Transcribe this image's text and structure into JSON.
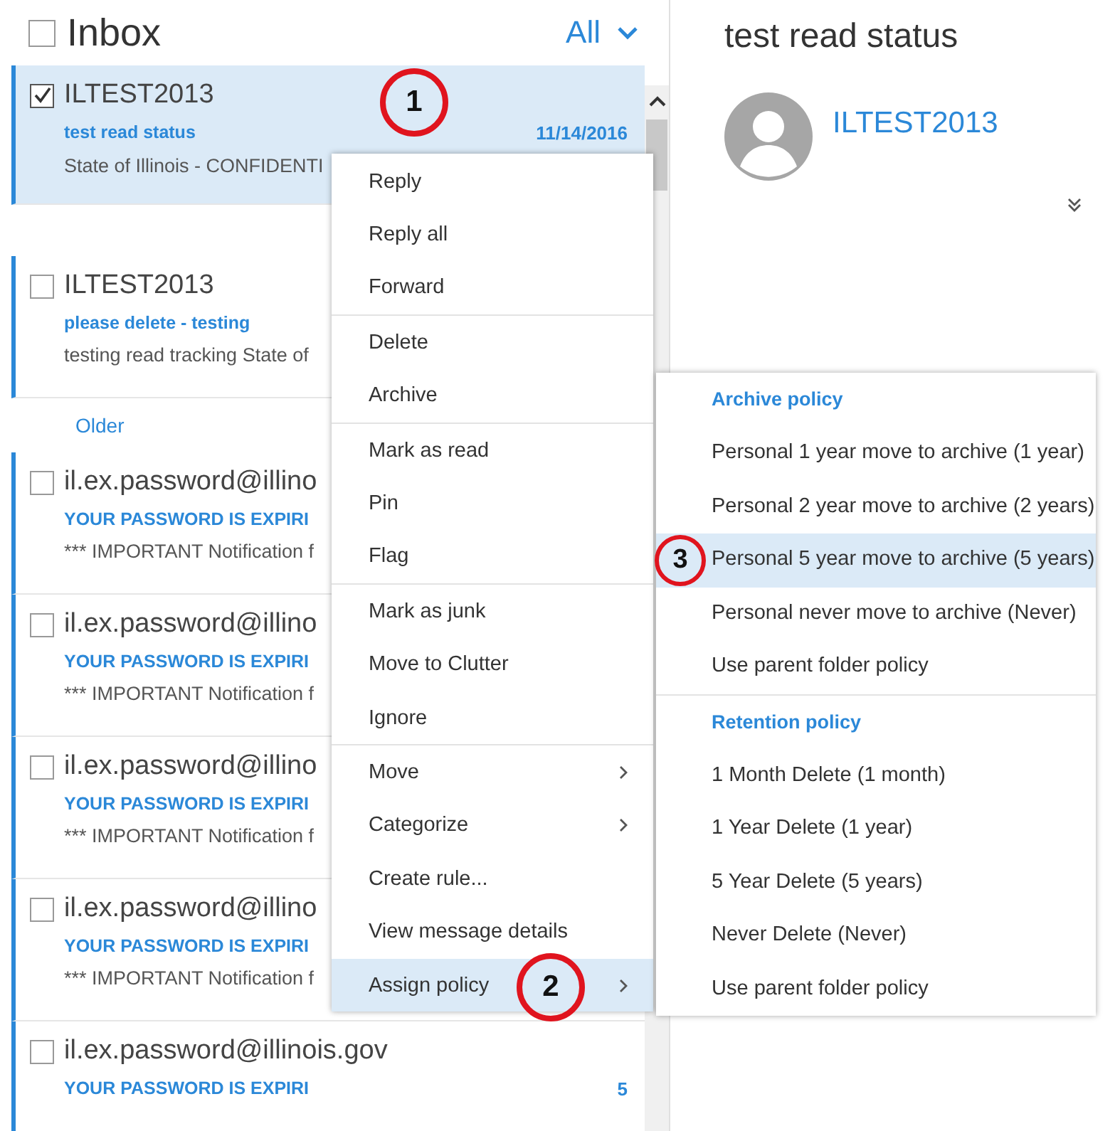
{
  "list_header": {
    "title": "Inbox",
    "filter": "All",
    "checked": false
  },
  "messages": [
    {
      "sender": "ILTEST2013",
      "subject": "test read status",
      "date": "11/14/2016",
      "preview": "State of Illinois - CONFIDENTI",
      "checked": true,
      "selected": true
    },
    {
      "sender": "ILTEST2013",
      "subject": "please delete - testing",
      "preview": "testing read tracking State of",
      "checked": false,
      "selected": false
    },
    {
      "group": "Older",
      "sender": "il.ex.password@illino",
      "subject": "YOUR PASSWORD IS EXPIRI",
      "preview": "*** IMPORTANT Notification f",
      "checked": false,
      "selected": false
    },
    {
      "sender": "il.ex.password@illino",
      "subject": "YOUR PASSWORD IS EXPIRI",
      "preview": "*** IMPORTANT Notification f",
      "checked": false,
      "selected": false
    },
    {
      "sender": "il.ex.password@illino",
      "subject": "YOUR PASSWORD IS EXPIRI",
      "preview": "*** IMPORTANT Notification f",
      "checked": false,
      "selected": false
    },
    {
      "sender": "il.ex.password@illino",
      "subject": "YOUR PASSWORD IS EXPIRI",
      "preview": "*** IMPORTANT Notification f",
      "checked": false,
      "selected": false
    },
    {
      "sender": "il.ex.password@illinois.gov",
      "subject": "YOUR PASSWORD IS EXPIRI",
      "date": "5",
      "checked": false,
      "selected": false
    }
  ],
  "reading_pane": {
    "title": "test read status",
    "sender": "ILTEST2013"
  },
  "context_menu": {
    "groups": [
      [
        {
          "label": "Reply",
          "submenu": false,
          "selected": false
        },
        {
          "label": "Reply all",
          "submenu": false,
          "selected": false
        },
        {
          "label": "Forward",
          "submenu": false,
          "selected": false
        }
      ],
      [
        {
          "label": "Delete",
          "submenu": false,
          "selected": false
        },
        {
          "label": "Archive",
          "submenu": false,
          "selected": false
        }
      ],
      [
        {
          "label": "Mark as read",
          "submenu": false,
          "selected": false
        },
        {
          "label": "Pin",
          "submenu": false,
          "selected": false
        },
        {
          "label": "Flag",
          "submenu": false,
          "selected": false
        }
      ],
      [
        {
          "label": "Mark as junk",
          "submenu": false,
          "selected": false
        },
        {
          "label": "Move to Clutter",
          "submenu": false,
          "selected": false
        },
        {
          "label": "Ignore",
          "submenu": false,
          "selected": false
        }
      ],
      [
        {
          "label": "Move",
          "submenu": true,
          "selected": false
        },
        {
          "label": "Categorize",
          "submenu": true,
          "selected": false
        },
        {
          "label": "Create rule...",
          "submenu": false,
          "selected": false
        },
        {
          "label": "View message details",
          "submenu": false,
          "selected": false
        },
        {
          "label": "Assign policy",
          "submenu": true,
          "selected": true
        }
      ]
    ]
  },
  "policy_menu": {
    "sections": [
      {
        "heading": "Archive policy",
        "items": [
          {
            "label": "Personal 1 year move to archive (1 year)",
            "selected": false
          },
          {
            "label": "Personal 2 year move to archive (2 years)",
            "selected": false
          },
          {
            "label": "Personal 5 year move to archive (5 years)",
            "selected": true
          },
          {
            "label": "Personal never move to archive (Never)",
            "selected": false
          },
          {
            "label": "Use parent folder policy",
            "selected": false
          }
        ]
      },
      {
        "heading": "Retention policy",
        "items": [
          {
            "label": "1 Month Delete (1 month)",
            "selected": false
          },
          {
            "label": "1 Year Delete (1 year)",
            "selected": false
          },
          {
            "label": "5 Year Delete (5 years)",
            "selected": false
          },
          {
            "label": "Never Delete (Never)",
            "selected": false
          },
          {
            "label": "Use parent folder policy",
            "selected": false
          }
        ]
      }
    ]
  },
  "annotations": [
    {
      "label": "1",
      "kind": "step"
    },
    {
      "label": "2",
      "kind": "step"
    },
    {
      "label": "3",
      "kind": "step"
    }
  ]
}
